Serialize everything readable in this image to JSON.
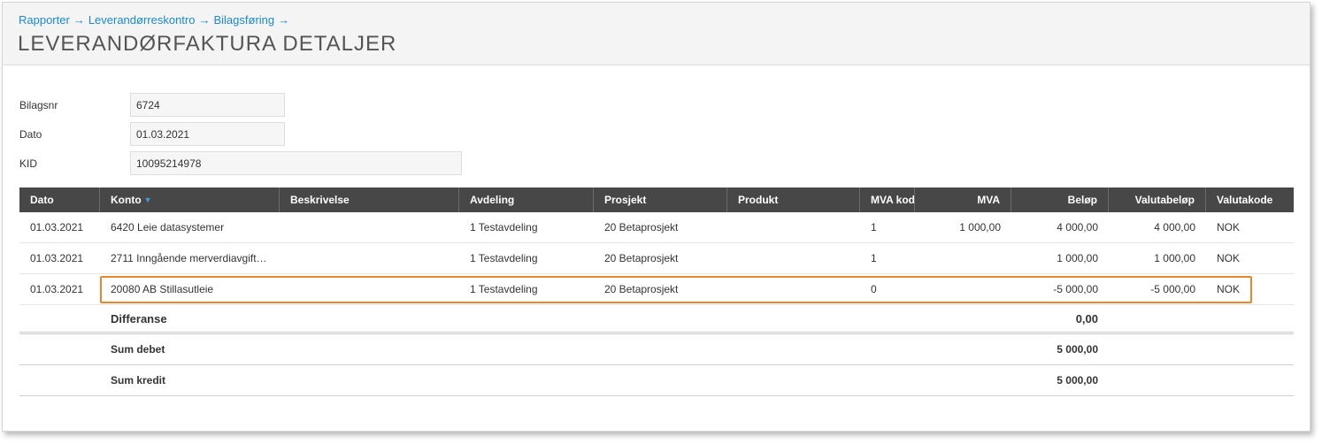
{
  "breadcrumb": [
    "Rapporter",
    "Leverandørreskontro",
    "Bilagsføring"
  ],
  "breadcrumb_separator": "→",
  "page_title": "LEVERANDØRFAKTURA DETALJER",
  "form": {
    "bilagsnr_label": "Bilagsnr",
    "bilagsnr_value": "6724",
    "dato_label": "Dato",
    "dato_value": "01.03.2021",
    "kid_label": "KID",
    "kid_value": "10095214978"
  },
  "table": {
    "columns": [
      "Dato",
      "Konto",
      "Beskrivelse",
      "Avdeling",
      "Prosjekt",
      "Produkt",
      "MVA kod",
      "MVA",
      "Beløp",
      "Valutabeløp",
      "Valutakode"
    ],
    "sort_icon": "sort-desc-icon",
    "rows": [
      [
        "01.03.2021",
        "6420 Leie datasystemer",
        "",
        "1 Testavdeling",
        "20 Betaprosjekt",
        "",
        "1",
        "1 000,00",
        "4 000,00",
        "4 000,00",
        "NOK"
      ],
      [
        "01.03.2021",
        "2711 Inngående merverdiavgift…",
        "",
        "1 Testavdeling",
        "20 Betaprosjekt",
        "",
        "1",
        "",
        "1 000,00",
        "1 000,00",
        "NOK"
      ],
      [
        "01.03.2021",
        "20080 AB Stillasutleie",
        "",
        "1 Testavdeling",
        "20 Betaprosjekt",
        "",
        "0",
        "",
        "-5 000,00",
        "-5 000,00",
        "NOK"
      ]
    ],
    "highlighted_row_index": 2,
    "highlight_color": "#e8872b",
    "differanse_label": "Differanse",
    "differanse_value": "0,00",
    "sum_debet_label": "Sum debet",
    "sum_debet_value": "5 000,00",
    "sum_kredit_label": "Sum kredit",
    "sum_kredit_value": "5 000,00"
  },
  "colors": {
    "link": "#1a8ad0",
    "table_header_bg": "#474747",
    "header_bg": "#f4f4f4"
  }
}
